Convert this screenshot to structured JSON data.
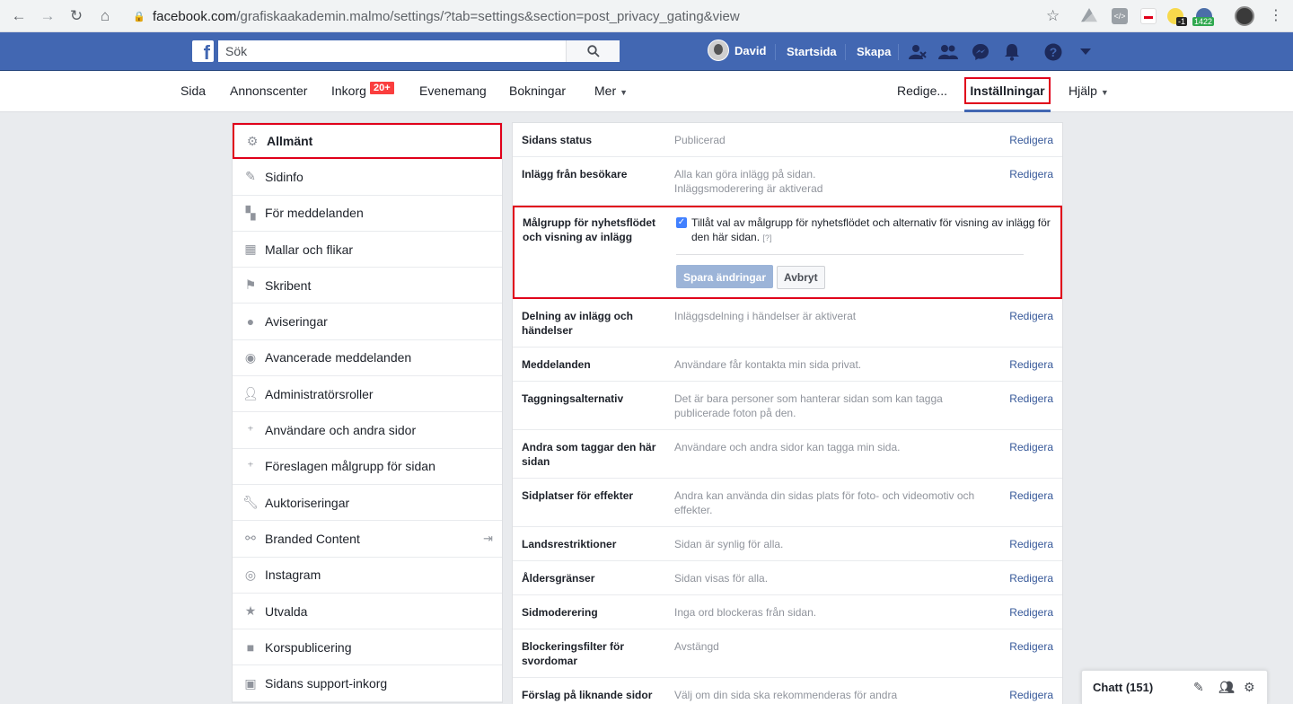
{
  "browser": {
    "url_host": "facebook.com",
    "url_path": "/grafiskaakademin.malmo/settings/?tab=settings&section=post_privacy_gating&view",
    "ext_badge_1": "-1",
    "ext_badge_2": "1422"
  },
  "topbar": {
    "search_placeholder": "Sök",
    "user_name": "David",
    "home_label": "Startsida",
    "create_label": "Skapa"
  },
  "page_tabs": {
    "sida": "Sida",
    "annonscenter": "Annonscenter",
    "inkorg": "Inkorg",
    "inkorg_badge": "20+",
    "evenemang": "Evenemang",
    "bokningar": "Bokningar",
    "mer": "Mer",
    "redigera": "Redige...",
    "installningar": "Inställningar",
    "hjalp": "Hjälp"
  },
  "sidebar": {
    "items": [
      {
        "label": "Allmänt",
        "icon": "gear-icon"
      },
      {
        "label": "Sidinfo",
        "icon": "pencil-icon"
      },
      {
        "label": "För meddelanden",
        "icon": "chat-bubbles-icon"
      },
      {
        "label": "Mallar och flikar",
        "icon": "grid-icon"
      },
      {
        "label": "Skribent",
        "icon": "flag-icon"
      },
      {
        "label": "Aviseringar",
        "icon": "globe-icon"
      },
      {
        "label": "Avancerade meddelanden",
        "icon": "messenger-icon"
      },
      {
        "label": "Administratörsroller",
        "icon": "person-icon"
      },
      {
        "label": "Användare och andra sidor",
        "icon": "person-plus-icon"
      },
      {
        "label": "Föreslagen målgrupp för sidan",
        "icon": "person-plus-icon"
      },
      {
        "label": "Auktoriseringar",
        "icon": "wrench-icon"
      },
      {
        "label": "Branded Content",
        "icon": "handshake-icon"
      },
      {
        "label": "Instagram",
        "icon": "instagram-icon"
      },
      {
        "label": "Utvalda",
        "icon": "star-icon"
      },
      {
        "label": "Korspublicering",
        "icon": "video-icon"
      },
      {
        "label": "Sidans support-inkorg",
        "icon": "facebook-icon"
      }
    ]
  },
  "settings": {
    "edit_label": "Redigera",
    "rows": [
      {
        "label": "Sidans status",
        "value": "Publicerad"
      },
      {
        "label": "Inlägg från besökare",
        "value": "Alla kan göra inlägg på sidan.",
        "value2": "Inläggsmoderering är aktiverad"
      },
      {
        "label": "Delning av inlägg och händelser",
        "value": "Inläggsdelning i händelser är aktiverat"
      },
      {
        "label": "Meddelanden",
        "value": "Användare får kontakta min sida privat."
      },
      {
        "label": "Taggningsalternativ",
        "value": "Det är bara personer som hanterar sidan som kan tagga publicerade foton på den."
      },
      {
        "label": "Andra som taggar den här sidan",
        "value": "Användare och andra sidor kan tagga min sida."
      },
      {
        "label": "Sidplatser för effekter",
        "value": "Andra kan använda din sidas plats för foto- och videomotiv och effekter."
      },
      {
        "label": "Landsrestriktioner",
        "value": "Sidan är synlig för alla."
      },
      {
        "label": "Åldersgränser",
        "value": "Sidan visas för alla."
      },
      {
        "label": "Sidmoderering",
        "value": "Inga ord blockeras från sidan."
      },
      {
        "label": "Blockeringsfilter för svordomar",
        "value": "Avstängd"
      },
      {
        "label": "Förslag på liknande sidor",
        "value": "Välj om din sida ska rekommenderas för andra"
      }
    ],
    "edit_row": {
      "label": "Målgrupp för nyhetsflödet och visning av inlägg",
      "checkbox_text": "Tillåt val av målgrupp för nyhetsflödet och alternativ för visning av inlägg för den här sidan.",
      "help": "[?]",
      "save": "Spara ändringar",
      "cancel": "Avbryt"
    }
  },
  "chat": {
    "label": "Chatt (151)"
  }
}
